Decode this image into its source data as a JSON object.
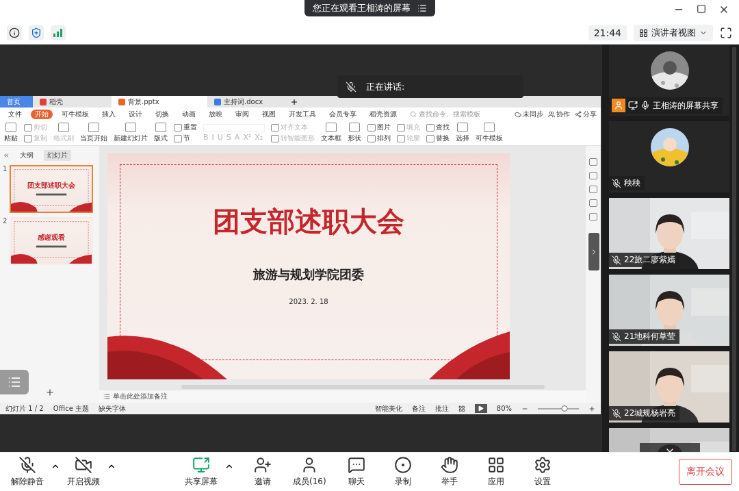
{
  "header": {
    "banner": "您正在观看王相涛的屏幕"
  },
  "toolbar": {
    "time": "21:44",
    "view": "演讲者视图"
  },
  "speaking": {
    "label": "正在讲话:"
  },
  "wps": {
    "tabs": [
      {
        "label": "首页",
        "kind": "home",
        "selected": false
      },
      {
        "label": "稻壳",
        "kind": "docer",
        "selected": false
      },
      {
        "label": "背景.pptx",
        "kind": "pptx",
        "selected": true
      },
      {
        "label": "主持词.docx",
        "kind": "docx",
        "selected": false
      }
    ],
    "menu": [
      {
        "label": "文件",
        "selected": false
      },
      {
        "label": "开始",
        "selected": true
      },
      {
        "label": "可牛模板",
        "selected": false
      },
      {
        "label": "插入",
        "selected": false
      },
      {
        "label": "设计",
        "selected": false
      },
      {
        "label": "切换",
        "selected": false
      },
      {
        "label": "动画",
        "selected": false
      },
      {
        "label": "放映",
        "selected": false
      },
      {
        "label": "审阅",
        "selected": false
      },
      {
        "label": "视图",
        "selected": false
      },
      {
        "label": "开发工具",
        "selected": false
      },
      {
        "label": "会员专享",
        "selected": false
      },
      {
        "label": "稻壳资源",
        "selected": false
      }
    ],
    "search": {
      "placeholder": "查找命令、搜索模板"
    },
    "actions": [
      "未同步",
      "协作",
      "分享"
    ],
    "ribbon": [
      {
        "kind": "large",
        "items": [
          {
            "label": "粘贴",
            "disabled": false
          }
        ]
      },
      {
        "kind": "pair",
        "items": [
          {
            "label": "剪切",
            "disabled": true
          },
          {
            "label": "复制",
            "disabled": true
          }
        ]
      },
      {
        "kind": "large",
        "items": [
          {
            "label": "格式刷",
            "disabled": true
          }
        ]
      },
      {
        "kind": "large",
        "items": [
          {
            "label": "当页开始",
            "disabled": false
          }
        ]
      },
      {
        "kind": "large",
        "items": [
          {
            "label": "新建幻灯片",
            "disabled": false
          }
        ]
      },
      {
        "kind": "large",
        "items": [
          {
            "label": "版式",
            "disabled": false
          }
        ]
      },
      {
        "kind": "pair",
        "items": [
          {
            "label": "重置",
            "disabled": false
          },
          {
            "label": "节",
            "disabled": false
          }
        ]
      },
      {
        "kind": "format",
        "items": [
          {
            "label": "B",
            "disabled": true
          },
          {
            "label": "I",
            "disabled": true
          },
          {
            "label": "U",
            "disabled": true
          },
          {
            "label": "S",
            "disabled": true
          },
          {
            "label": "A",
            "disabled": true
          },
          {
            "label": "X²",
            "disabled": true
          },
          {
            "label": "X₂",
            "disabled": true
          }
        ]
      },
      {
        "kind": "pair",
        "items": [
          {
            "label": "对齐文本",
            "disabled": true
          },
          {
            "label": "转智能图形",
            "disabled": true
          }
        ]
      },
      {
        "kind": "large",
        "items": [
          {
            "label": "文本框",
            "disabled": false
          }
        ]
      },
      {
        "kind": "large",
        "items": [
          {
            "label": "形状",
            "disabled": false
          }
        ]
      },
      {
        "kind": "pair",
        "items": [
          {
            "label": "图片",
            "disabled": false
          },
          {
            "label": "排列",
            "disabled": false
          }
        ]
      },
      {
        "kind": "pair",
        "items": [
          {
            "label": "填充",
            "disabled": true
          },
          {
            "label": "轮廓",
            "disabled": true
          }
        ]
      },
      {
        "kind": "pair",
        "items": [
          {
            "label": "查找",
            "disabled": false
          },
          {
            "label": "替换",
            "disabled": false
          }
        ]
      },
      {
        "kind": "large",
        "items": [
          {
            "label": "选择",
            "disabled": false
          }
        ]
      },
      {
        "kind": "large",
        "items": [
          {
            "label": "可牛模板",
            "disabled": false
          }
        ]
      }
    ],
    "panel_tabs": [
      {
        "label": "大纲",
        "selected": false
      },
      {
        "label": "幻灯片",
        "selected": true
      }
    ],
    "slides": [
      {
        "number": "1",
        "title": "团支部述职大会",
        "selected": true
      },
      {
        "number": "2",
        "title": "感谢观看",
        "selected": false
      }
    ],
    "slide": {
      "title": "团支部述职大会",
      "subtitle": "旅游与规划学院团委",
      "date": "2023. 2. 18"
    },
    "notes": {
      "placeholder": "单击此处添加备注"
    },
    "status": {
      "slide_count": "幻灯片 1 / 2",
      "theme": "Office 主题",
      "font": "缺失字体",
      "beautify": "智能美化",
      "notes": "备注",
      "comments": "批注",
      "zoom": "80%",
      "zoom_slider": {
        "level": 0.65
      }
    }
  },
  "participants": [
    {
      "name": "王相涛的屏幕共享",
      "kind": "screen",
      "muted": false
    },
    {
      "name": "秧秧",
      "kind": "avatar",
      "muted": true
    },
    {
      "name": "22旅二廖紫嫣",
      "kind": "video",
      "muted": true
    },
    {
      "name": "21地科何草莹",
      "kind": "video",
      "muted": true
    },
    {
      "name": "22城规杨岩亮",
      "kind": "video",
      "muted": true
    },
    {
      "kind": "video"
    }
  ],
  "controls": [
    {
      "label": "解除静音",
      "kind": "mic",
      "off": true,
      "caret": true
    },
    {
      "label": "开启视频",
      "kind": "camera",
      "off": true,
      "caret": true
    },
    {
      "label": "共享屏幕",
      "kind": "share",
      "off": false,
      "caret": true
    },
    {
      "label": "邀请",
      "kind": "invite",
      "off": false,
      "caret": false
    },
    {
      "label": "成员(16)",
      "kind": "members",
      "off": false,
      "caret": false
    },
    {
      "label": "聊天",
      "kind": "chat",
      "off": false,
      "caret": false
    },
    {
      "label": "录制",
      "kind": "record",
      "off": false,
      "caret": false
    },
    {
      "label": "举手",
      "kind": "hand",
      "off": false,
      "caret": false
    },
    {
      "label": "应用",
      "kind": "apps",
      "off": false,
      "caret": false
    },
    {
      "label": "设置",
      "kind": "settings",
      "off": false,
      "caret": false
    }
  ],
  "leave": {
    "label": "离开会议"
  }
}
